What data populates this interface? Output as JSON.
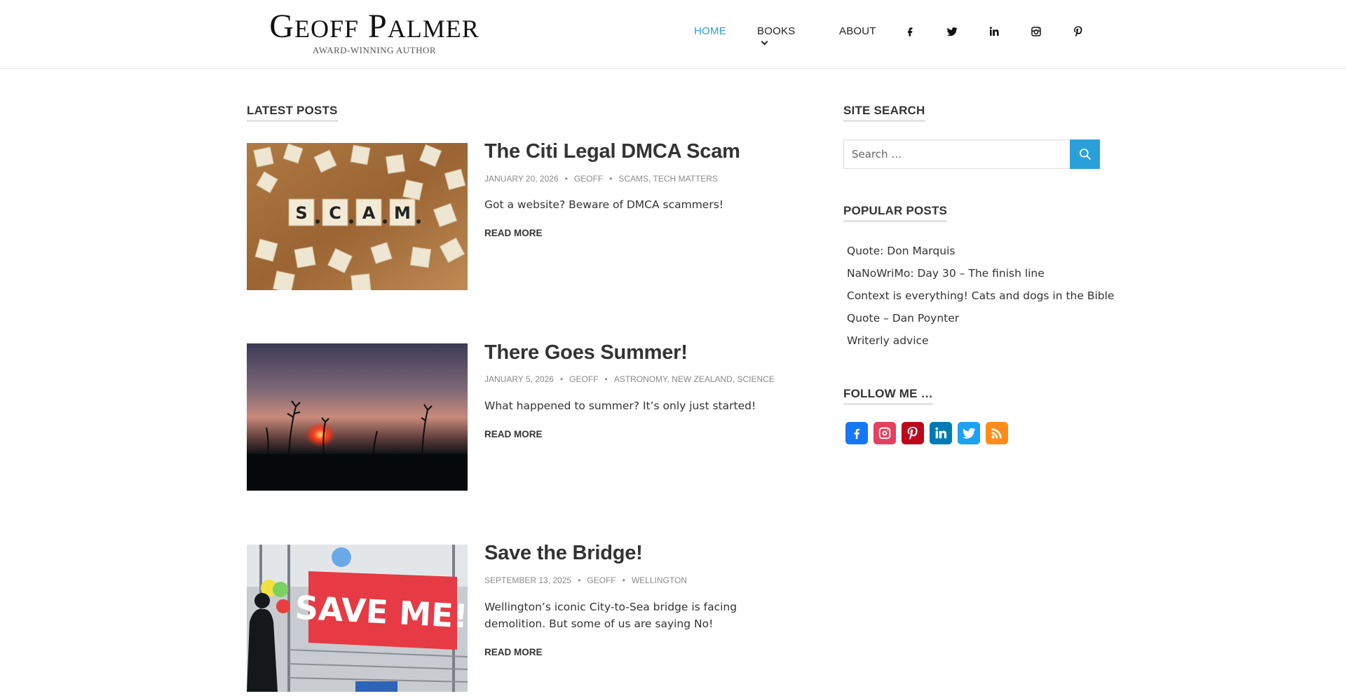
{
  "site": {
    "title_first_initial": "G",
    "title_first_rest": "EOFF",
    "title_last_initial": "P",
    "title_last_rest": "ALMER",
    "tagline": "AWARD-WINNING AUTHOR"
  },
  "nav": {
    "items": [
      {
        "label": "HOME"
      },
      {
        "label": "BOOKS"
      },
      {
        "label": "ABOUT"
      }
    ],
    "active_color": "#2a9ed8",
    "social_icons": [
      "facebook-icon",
      "twitter-icon",
      "linkedin-icon",
      "instagram-icon",
      "pinterest-icon"
    ]
  },
  "main": {
    "heading": "LATEST POSTS",
    "posts": [
      {
        "title": "The Citi Legal DMCA Scam",
        "date": "JANUARY 20, 2026",
        "author": "GEOFF",
        "categories": "SCAMS, TECH MATTERS",
        "excerpt": "Got a website? Beware of DMCA scammers!",
        "read_more": "READ MORE",
        "image_text": "S.C.A.M."
      },
      {
        "title": "There Goes Summer!",
        "date": "JANUARY 5, 2026",
        "author": "GEOFF",
        "categories": "ASTRONOMY, NEW ZEALAND, SCIENCE",
        "excerpt": "What happened to summer? It’s only just started!",
        "read_more": "READ MORE"
      },
      {
        "title": "Save the Bridge!",
        "date": "SEPTEMBER 13, 2025",
        "author": "GEOFF",
        "categories": "WELLINGTON",
        "excerpt": "Wellington’s iconic City-to-Sea bridge is facing demolition. But some of us are saying No!",
        "read_more": "READ MORE",
        "image_text": "SAVE ME!"
      }
    ]
  },
  "sidebar": {
    "search_heading": "SITE SEARCH",
    "search_placeholder": "Search …",
    "popular_heading": "POPULAR POSTS",
    "popular": [
      "Quote: Don Marquis",
      "NaNoWriMo: Day 30 – The finish line",
      "Context is everything! Cats and dogs in the Bible",
      "Quote – Dan Poynter",
      "Writerly advice"
    ],
    "follow_heading": "FOLLOW ME …",
    "follow": [
      {
        "icon": "facebook-icon",
        "color": "#1877f2"
      },
      {
        "icon": "instagram-icon",
        "color": "#e4405f"
      },
      {
        "icon": "pinterest-icon",
        "color": "#bd081c"
      },
      {
        "icon": "linkedin-icon",
        "color": "#007bb5"
      },
      {
        "icon": "twitter-icon",
        "color": "#1da1f2"
      },
      {
        "icon": "rss-icon",
        "color": "#ff8c1a"
      }
    ]
  }
}
